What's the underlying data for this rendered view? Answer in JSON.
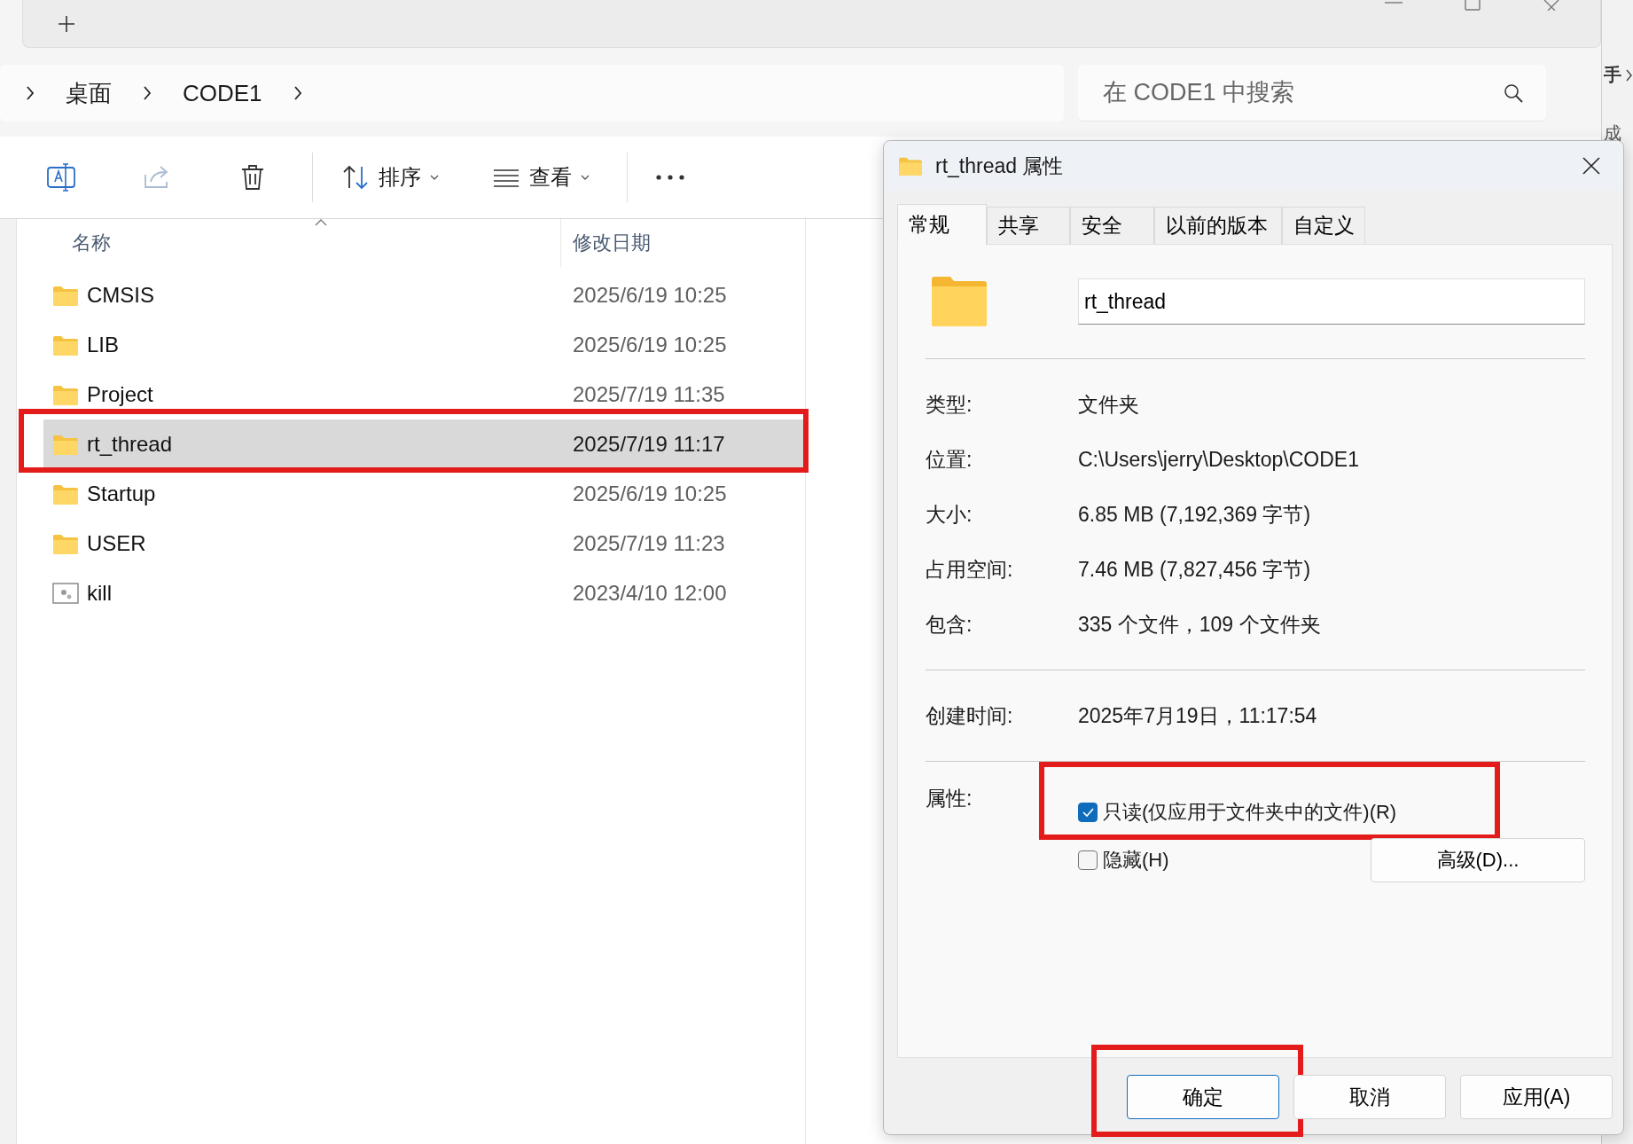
{
  "explorer": {
    "breadcrumb": [
      "桌面",
      "CODE1"
    ],
    "search": {
      "placeholder": "在 CODE1 中搜索"
    },
    "toolbar": [
      {
        "kind": "rename",
        "disabled": false
      },
      {
        "kind": "share",
        "disabled": true
      },
      {
        "kind": "delete",
        "disabled": false
      },
      {
        "kind": "sort",
        "label": "排序",
        "disabled": false
      },
      {
        "kind": "view",
        "label": "查看",
        "disabled": false
      },
      {
        "kind": "more",
        "disabled": false
      }
    ],
    "columns": [
      "名称",
      "修改日期"
    ],
    "rows": [
      {
        "kind": "folder",
        "name": "CMSIS",
        "date": "2025/6/19 10:25",
        "selected": false,
        "annotated": false
      },
      {
        "kind": "folder",
        "name": "LIB",
        "date": "2025/6/19 10:25",
        "selected": false,
        "annotated": false
      },
      {
        "kind": "folder",
        "name": "Project",
        "date": "2025/7/19 11:35",
        "selected": false,
        "annotated": false
      },
      {
        "kind": "folder",
        "name": "rt_thread",
        "date": "2025/7/19 11:17",
        "selected": true,
        "annotated": true
      },
      {
        "kind": "folder",
        "name": "Startup",
        "date": "2025/6/19 10:25",
        "selected": false,
        "annotated": false
      },
      {
        "kind": "folder",
        "name": "USER",
        "date": "2025/7/19 11:23",
        "selected": false,
        "annotated": false
      },
      {
        "kind": "app",
        "name": "kill",
        "date": "2023/4/10 12:00",
        "selected": false,
        "annotated": false
      }
    ]
  },
  "background_fragments": [
    "手",
    "成"
  ],
  "dialog": {
    "title": "rt_thread 属性",
    "tabs": [
      {
        "label": "常规",
        "selected": true
      },
      {
        "label": "共享",
        "selected": false
      },
      {
        "label": "安全",
        "selected": false
      },
      {
        "label": "以前的版本",
        "selected": false
      },
      {
        "label": "自定义",
        "selected": false
      }
    ],
    "name": "rt_thread",
    "sections": [
      [
        {
          "label": "类型:",
          "value": "文件夹"
        },
        {
          "label": "位置:",
          "value": "C:\\Users\\jerry\\Desktop\\CODE1"
        },
        {
          "label": "大小:",
          "value": "6.85 MB (7,192,369 字节)"
        },
        {
          "label": "占用空间:",
          "value": "7.46 MB (7,827,456 字节)"
        },
        {
          "label": "包含:",
          "value": "335 个文件，109 个文件夹"
        }
      ],
      [
        {
          "label": "创建时间:",
          "value": "2025年7月19日，11:17:54"
        }
      ]
    ],
    "attributes_label": "属性:",
    "attributes": [
      {
        "label": "只读(仅应用于文件夹中的文件)(R)",
        "checked": true,
        "annotated": true
      },
      {
        "label": "隐藏(H)",
        "checked": false,
        "annotated": false
      }
    ],
    "advanced_button": "高级(D)...",
    "buttons": [
      {
        "label": "确定",
        "default": true,
        "annotated": true
      },
      {
        "label": "取消",
        "default": false,
        "annotated": false
      },
      {
        "label": "应用(A)",
        "default": false,
        "annotated": false
      }
    ]
  }
}
